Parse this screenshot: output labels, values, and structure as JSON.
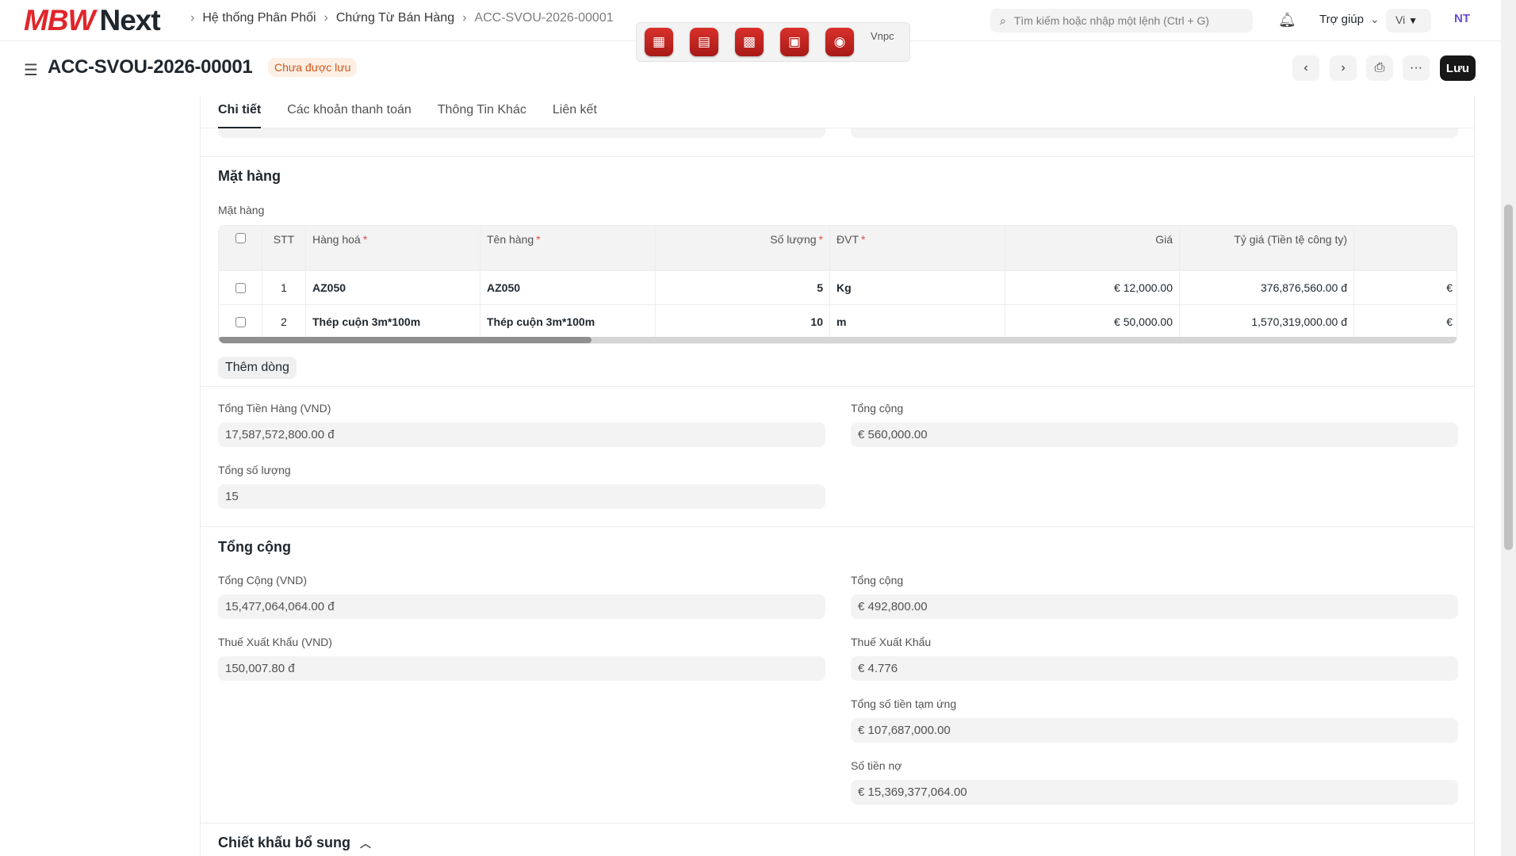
{
  "brand": {
    "part1": "MBW",
    "part2": "Next"
  },
  "breadcrumbs": [
    "Hệ thống Phân Phối",
    "Chứng Từ Bán Hàng",
    "ACC-SVOU-2026-00001"
  ],
  "app_strip": {
    "broken_image_alt": "Vnpc"
  },
  "search": {
    "placeholder": "Tìm kiếm hoặc nhập một lệnh (Ctrl + G)"
  },
  "help_label": "Trợ giúp",
  "language": "Vi",
  "avatar_initials": "NT",
  "doc": {
    "title": "ACC-SVOU-2026-00001",
    "status": "Chưa được lưu",
    "save_label": "Lưu"
  },
  "tabs": [
    "Chi tiết",
    "Các khoản thanh toán",
    "Thông Tin Khác",
    "Liên kết"
  ],
  "items_section": {
    "title": "Mặt hàng",
    "table_label": "Mặt hàng",
    "columns": [
      "STT",
      "Hàng hoá",
      "Tên hàng",
      "Số lượng",
      "ĐVT",
      "Giá",
      "Tỷ giá (Tiền tệ công ty)"
    ],
    "rows": [
      {
        "stt": "1",
        "item_code": "AZ050",
        "item_name": "AZ050",
        "qty": "5",
        "uom": "Kg",
        "rate": "€ 12,000.00",
        "base_rate": "376,876,560.00 đ",
        "overflow": "€"
      },
      {
        "stt": "2",
        "item_code": "Thép cuộn 3m*100m",
        "item_name": "Thép cuộn 3m*100m",
        "qty": "10",
        "uom": "m",
        "rate": "€ 50,000.00",
        "base_rate": "1,570,319,000.00 đ",
        "overflow": "€"
      }
    ],
    "add_row_label": "Thêm dòng"
  },
  "item_totals": {
    "base_total_label": "Tổng Tiền Hàng (VND)",
    "base_total": "17,587,572,800.00 đ",
    "total_label": "Tổng cộng",
    "total": "€ 560,000.00",
    "total_qty_label": "Tổng số lượng",
    "total_qty": "15"
  },
  "totals_section": {
    "title": "Tổng cộng",
    "base_grand_total_label": "Tổng Cộng (VND)",
    "base_grand_total": "15,477,064,064.00 đ",
    "grand_total_label": "Tổng cộng",
    "grand_total": "€ 492,800.00",
    "base_export_tax_label": "Thuế Xuất Khẩu (VND)",
    "base_export_tax": "150,007.80 đ",
    "export_tax_label": "Thuế Xuất Khẩu",
    "export_tax": "€ 4.776",
    "advance_label": "Tổng số tiền tạm ứng",
    "advance": "€ 107,687,000.00",
    "outstanding_label": "Số tiền nợ",
    "outstanding": "€ 15,369,377,064.00"
  },
  "discount_section": {
    "title": "Chiết khấu bổ sung"
  },
  "colors": {
    "brand_red": "#e0262b",
    "status_orange": "#d3571b",
    "primary_dark": "#171717"
  }
}
